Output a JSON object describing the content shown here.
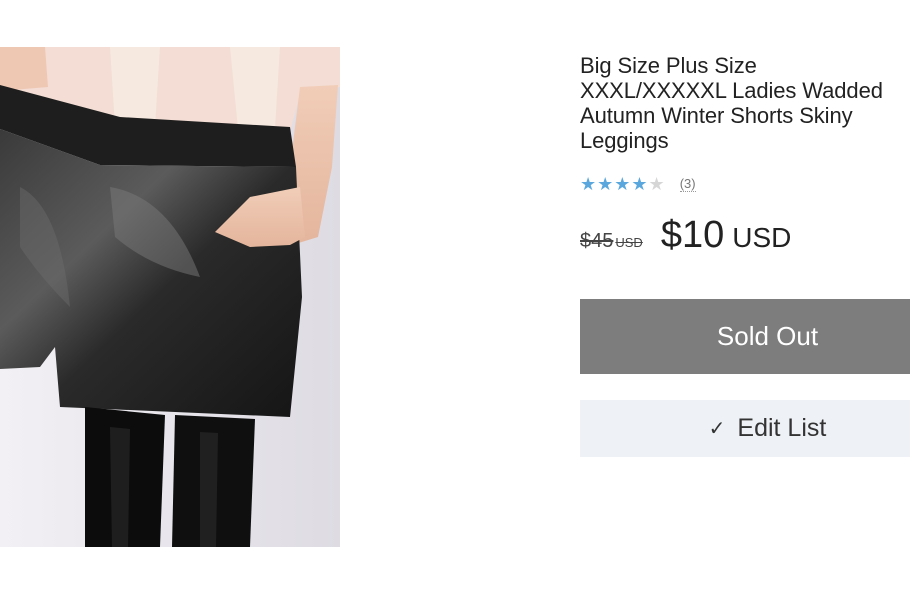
{
  "product": {
    "title": "Big Size Plus Size\nXXXL/XXXXXL Ladies Wadded\nAutumn Winter Shorts Skiny\nLeggings",
    "image_icon": "product-photo",
    "rating": {
      "stars_filled": 4,
      "stars_total": 5,
      "filled_star_glyph": "★★★★",
      "empty_star_glyph": "★",
      "review_count": "(3)",
      "star_color": "#5aa7dd"
    },
    "price": {
      "original_amount": "$45",
      "original_currency": "USD",
      "current_amount": "$10",
      "current_currency": "USD"
    }
  },
  "actions": {
    "sold_out_label": "Sold Out",
    "sold_out_color": "#7d7d7d",
    "edit_list_label": "Edit List",
    "edit_list_icon": "checkmark-icon",
    "edit_list_glyph": "✓"
  }
}
